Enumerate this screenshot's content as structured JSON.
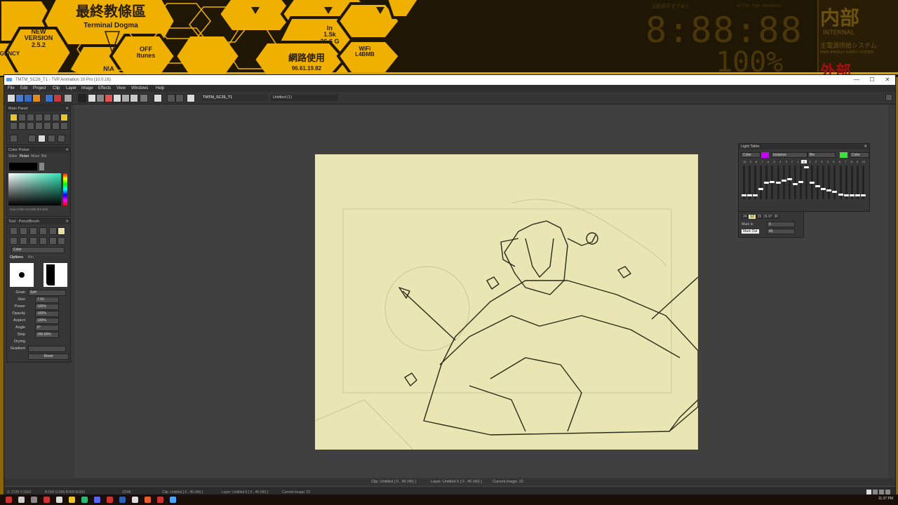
{
  "wallpaper": {
    "hex_title_jp": "最終教條區",
    "hex_title_en": "Terminal Dogma",
    "version_label": "NEW\nVERSION\n2.5.2",
    "itunes_label": "OFF\nItunes",
    "gency_label": "GENCY",
    "nva_label": "N\\A",
    "net_in": "In\n1.5k\n26.6 G",
    "network_label": "網路使用",
    "ip_address": "96.61.19.82",
    "wifi_label": "WiFi\nL4BMB",
    "clock": "8:88:88",
    "percent": "100%",
    "internal_jp": "内部",
    "internal_en": "INTERNAL",
    "power_jp": "主電源供給システム",
    "power_en": "MAIN ENERGY SUPPLY SYSTEM",
    "external_jp": "外部",
    "countdown_jp": "活動限界まであと",
    "active_time": "ACTIVE TIME REMAINING"
  },
  "window": {
    "title": "TMTM_SC26_T1 - TVP Animation 10 Pro (10.0.16)",
    "minimize": "—",
    "maximize": "☐",
    "close": "✕"
  },
  "menu": [
    "File",
    "Edit",
    "Project",
    "Clip",
    "Layer",
    "Image",
    "Effects",
    "View",
    "Windows",
    "Help"
  ],
  "tabs": [
    "TMTM_SC26_T1",
    "Untitled (1)"
  ],
  "main_panel": {
    "title": "Main Panel"
  },
  "color_picker": {
    "title": "Color Picker",
    "tabs": [
      "Slider",
      "Picker",
      "Mixer",
      "Bin"
    ],
    "readout": "Hue 0.000 S:0.000 B:0.000",
    "accent_color": "#2ee6b5"
  },
  "tool_panel": {
    "title": "Tool : PencilBrush",
    "mode": "Color",
    "tabs": [
      "Options",
      "Bin"
    ],
    "params": [
      {
        "label": "Grain",
        "value": "Soft"
      },
      {
        "label": "Size",
        "value": "7.50"
      },
      {
        "label": "Power",
        "value": "100%"
      },
      {
        "label": "Opacity",
        "value": "100%"
      },
      {
        "label": "Aspect",
        "value": "100%"
      },
      {
        "label": "Angle",
        "value": "0°"
      },
      {
        "label": "Step",
        "value": "290.00%"
      },
      {
        "label": "Drying",
        "value": ""
      },
      {
        "label": "Gradient",
        "value": ""
      }
    ],
    "reset": "Reset"
  },
  "light_table": {
    "title": "Light Table",
    "left_mode": "Color",
    "left_color": "#c800ff",
    "instance": "Instance",
    "bin": "Bin",
    "right_color": "#3ce23c",
    "right_mode": "Color",
    "numbers": [
      "10",
      "9",
      "8",
      "7",
      "6",
      "5",
      "4",
      "3",
      "2",
      "1",
      "0",
      "1",
      "2",
      "3",
      "4",
      "5",
      "6",
      "7",
      "8",
      "9",
      "10"
    ],
    "levels": [
      0.08,
      0.08,
      0.08,
      0.3,
      0.5,
      0.52,
      0.5,
      0.55,
      0.6,
      0.45,
      0.52,
      0.98,
      0.5,
      0.38,
      0.3,
      0.25,
      0.2,
      0.12,
      0.08,
      0.08,
      0.08,
      0.08
    ]
  },
  "light_table_2": {
    "fps_items": [
      "24",
      "12",
      "24",
      "25",
      "29.97",
      "30"
    ],
    "mark_in": "Mark In",
    "mark_in_value": "0",
    "mark_out": "Mark Out",
    "mark_out_value": "45"
  },
  "status": {
    "clip": "Clip: Untitled [ 0 , 45  (46) ]",
    "layer": "Layer: Untitled 6 [ 0 , 45  (46) ]",
    "current_image": "Current image: 22"
  },
  "bottom": {
    "coords": "X: 2735  Y:1010",
    "rgb": "R:000 G:000 B:000 A:000",
    "frame": "22/46",
    "clip": "Clip: Untitled [ 0 , 45  (46) ]",
    "layer": "Layer: Untitled 6 [ 0 , 45  (46) ]",
    "current": "Current image: 22"
  },
  "taskbar": {
    "time": "11:37 PM"
  }
}
